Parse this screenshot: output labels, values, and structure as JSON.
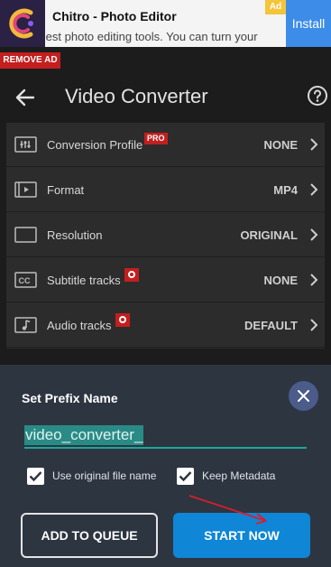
{
  "ad": {
    "title": "Chitro - Photo Editor",
    "description": "Best photo editing tools. You can turn your",
    "install_label": "Install",
    "tag": "Ad",
    "remove_label": "REMOVE AD"
  },
  "toolbar": {
    "title": "Video Converter",
    "back_icon": "arrow-left-icon",
    "help_icon": "help-circle-icon"
  },
  "settings": [
    {
      "label": "Conversion Profile",
      "value": "NONE",
      "badge": "PRO",
      "icon": "sliders-icon"
    },
    {
      "label": "Format",
      "value": "MP4",
      "badge": "",
      "icon": "film-icon"
    },
    {
      "label": "Resolution",
      "value": "ORIGINAL",
      "badge": "",
      "icon": "aspect-frame-icon"
    },
    {
      "label": "Subtitle tracks",
      "value": "NONE",
      "badge": "dot",
      "icon": "closed-caption-icon"
    },
    {
      "label": "Audio tracks",
      "value": "DEFAULT",
      "badge": "dot",
      "icon": "music-note-icon"
    }
  ],
  "sheet": {
    "title": "Set Prefix Name",
    "prefix_value": "video_converter_",
    "options": [
      {
        "label": "Use original file name",
        "checked": true
      },
      {
        "label": "Keep Metadata",
        "checked": true
      }
    ],
    "add_queue_label": "ADD TO QUEUE",
    "start_label": "START NOW"
  },
  "colors": {
    "accent_blue": "#0f86d6",
    "teal_underline": "#19a89a",
    "badge_red": "#c41e1e",
    "sheet_bg": "#2d3541"
  }
}
